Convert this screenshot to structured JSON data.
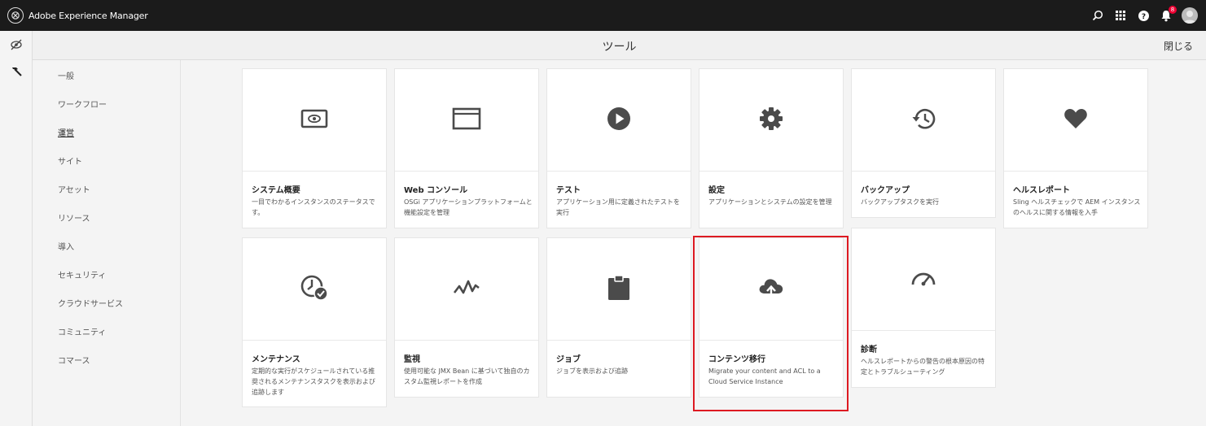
{
  "app": {
    "title": "Adobe Experience Manager",
    "notification_count": "8"
  },
  "header": {
    "title": "ツール",
    "close_label": "閉じる"
  },
  "rail": {
    "items": [
      "shortcuts-icon",
      "hammer-icon"
    ]
  },
  "nav": {
    "items": [
      {
        "label": "一般",
        "active": false
      },
      {
        "label": "ワークフロー",
        "active": false
      },
      {
        "label": "運営",
        "active": true
      },
      {
        "label": "サイト",
        "active": false
      },
      {
        "label": "アセット",
        "active": false
      },
      {
        "label": "リソース",
        "active": false
      },
      {
        "label": "導入",
        "active": false
      },
      {
        "label": "セキュリティ",
        "active": false
      },
      {
        "label": "クラウドサービス",
        "active": false
      },
      {
        "label": "コミュニティ",
        "active": false
      },
      {
        "label": "コマース",
        "active": false
      }
    ]
  },
  "cards": [
    {
      "title": "システム概要",
      "desc": "一目でわかるインスタンスのステータスです。",
      "icon": "eye-monitor-icon"
    },
    {
      "title": "Web コンソール",
      "desc": "OSGi アプリケーションプラットフォームと機能設定を管理",
      "icon": "window-icon"
    },
    {
      "title": "テスト",
      "desc": "アプリケーション用に定義されたテストを実行",
      "icon": "play-icon"
    },
    {
      "title": "設定",
      "desc": "アプリケーションとシステムの設定を管理",
      "icon": "gear-icon"
    },
    {
      "title": "バックアップ",
      "desc": "バックアップタスクを実行",
      "icon": "history-icon"
    },
    {
      "title": "ヘルスレポート",
      "desc": "Sling ヘルスチェックで AEM インスタンスのヘルスに関する情報を入手",
      "icon": "heart-icon"
    },
    {
      "title": "メンテナンス",
      "desc": "定期的な実行がスケジュールされている推奨されるメンテナンスタスクを表示および追跡します",
      "icon": "clock-check-icon"
    },
    {
      "title": "監視",
      "desc": "使用可能な JMX Bean に基づいて独自のカスタム監視レポートを作成",
      "icon": "pulse-icon"
    },
    {
      "title": "ジョブ",
      "desc": "ジョブを表示および追跡",
      "icon": "clipboard-icon"
    },
    {
      "title": "コンテンツ移行",
      "desc": "Migrate your content and ACL to a Cloud Service Instance",
      "icon": "cloud-upload-icon"
    },
    {
      "title": "診断",
      "desc": "ヘルスレポートからの警告の根本原因の特定とトラブルシューティング",
      "icon": "gauge-icon"
    }
  ],
  "colors": {
    "topbar": "#1b1b1b",
    "highlight": "#dd1a22",
    "icon": "#4b4b4b"
  }
}
